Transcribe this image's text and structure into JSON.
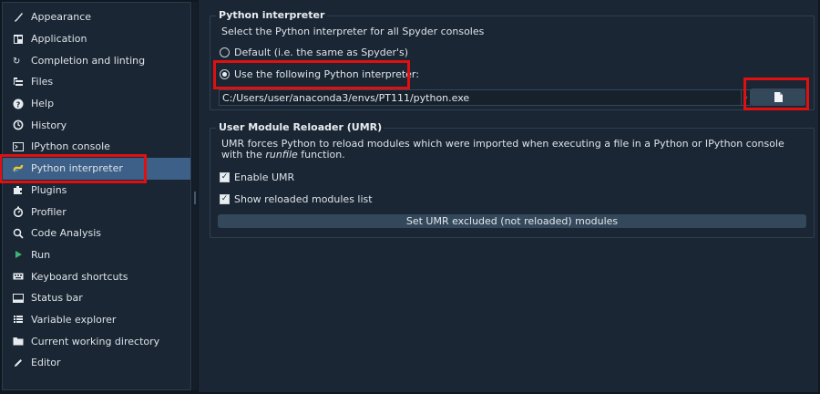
{
  "sidebar": {
    "items": [
      {
        "label": "Appearance",
        "icon": "paint-brush-icon"
      },
      {
        "label": "Application",
        "icon": "application-icon"
      },
      {
        "label": "Completion and linting",
        "icon": "completion-icon"
      },
      {
        "label": "Files",
        "icon": "files-icon"
      },
      {
        "label": "Help",
        "icon": "help-icon"
      },
      {
        "label": "History",
        "icon": "history-icon"
      },
      {
        "label": "IPython console",
        "icon": "ipython-console-icon"
      },
      {
        "label": "Python interpreter",
        "icon": "python-icon",
        "selected": true
      },
      {
        "label": "Plugins",
        "icon": "plugins-icon"
      },
      {
        "label": "Profiler",
        "icon": "profiler-icon"
      },
      {
        "label": "Code Analysis",
        "icon": "code-analysis-icon"
      },
      {
        "label": "Run",
        "icon": "run-icon"
      },
      {
        "label": "Keyboard shortcuts",
        "icon": "keyboard-icon"
      },
      {
        "label": "Status bar",
        "icon": "status-bar-icon"
      },
      {
        "label": "Variable explorer",
        "icon": "variable-explorer-icon"
      },
      {
        "label": "Current working directory",
        "icon": "folder-icon"
      },
      {
        "label": "Editor",
        "icon": "editor-icon"
      }
    ]
  },
  "interpreter": {
    "title": "Python interpreter",
    "description": "Select the Python interpreter for all Spyder consoles",
    "default_option": "Default (i.e. the same as Spyder's)",
    "custom_option": "Use the following Python interpreter:",
    "selected": "custom",
    "path_value": "C:/Users/user/anaconda3/envs/PT111/python.exe"
  },
  "umr": {
    "title": "User Module Reloader (UMR)",
    "description_prefix": "UMR forces Python to reload modules which were imported when executing a file in a Python or IPython console with the ",
    "description_emph": "runfile",
    "description_suffix": " function.",
    "enable_label": "Enable UMR",
    "enable_checked": true,
    "show_reloaded_label": "Show reloaded modules list",
    "show_reloaded_checked": true,
    "excluded_button": "Set UMR excluded (not reloaded) modules"
  },
  "colors": {
    "background": "#1a2633",
    "selection": "#3c6087",
    "highlight_annotation": "#e01010",
    "button": "#34485b"
  }
}
